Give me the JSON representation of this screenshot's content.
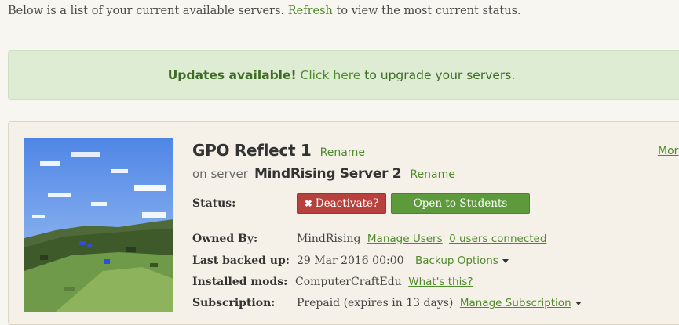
{
  "intro": {
    "text_before": "Below is a list of your current available servers.",
    "refresh_link": "Refresh",
    "text_after": "to view the most current status."
  },
  "alert": {
    "bold": "Updates available!",
    "link": "Click here",
    "rest": "to upgrade your servers."
  },
  "world": {
    "title": "GPO Reflect 1",
    "rename_label": "Rename",
    "more_label": "Mor",
    "server_prefix": "on server",
    "server_name": "MindRising Server 2",
    "server_rename_label": "Rename",
    "thumbnail_icon": "minecraft-world-thumbnail"
  },
  "status": {
    "label": "Status:",
    "deactivate_label": "Deactivate?",
    "deactivate_icon": "close-icon",
    "open_label": "Open to Students"
  },
  "owned": {
    "label": "Owned By:",
    "value": "MindRising",
    "manage_users": "Manage Users",
    "users_connected": "0 users connected"
  },
  "backup": {
    "label": "Last backed up:",
    "value": "29 Mar 2016 00:00",
    "options": "Backup Options"
  },
  "mods": {
    "label": "Installed mods:",
    "value": "ComputerCraftEdu",
    "whats_this": "What's this?"
  },
  "subscription": {
    "label": "Subscription:",
    "value": "Prepaid (expires in 13 days)",
    "manage": "Manage Subscription"
  },
  "colors": {
    "accent": "#4f8a2c",
    "danger": "#b8403d",
    "success": "#5c9a3c",
    "alert_bg": "#deecd4"
  }
}
